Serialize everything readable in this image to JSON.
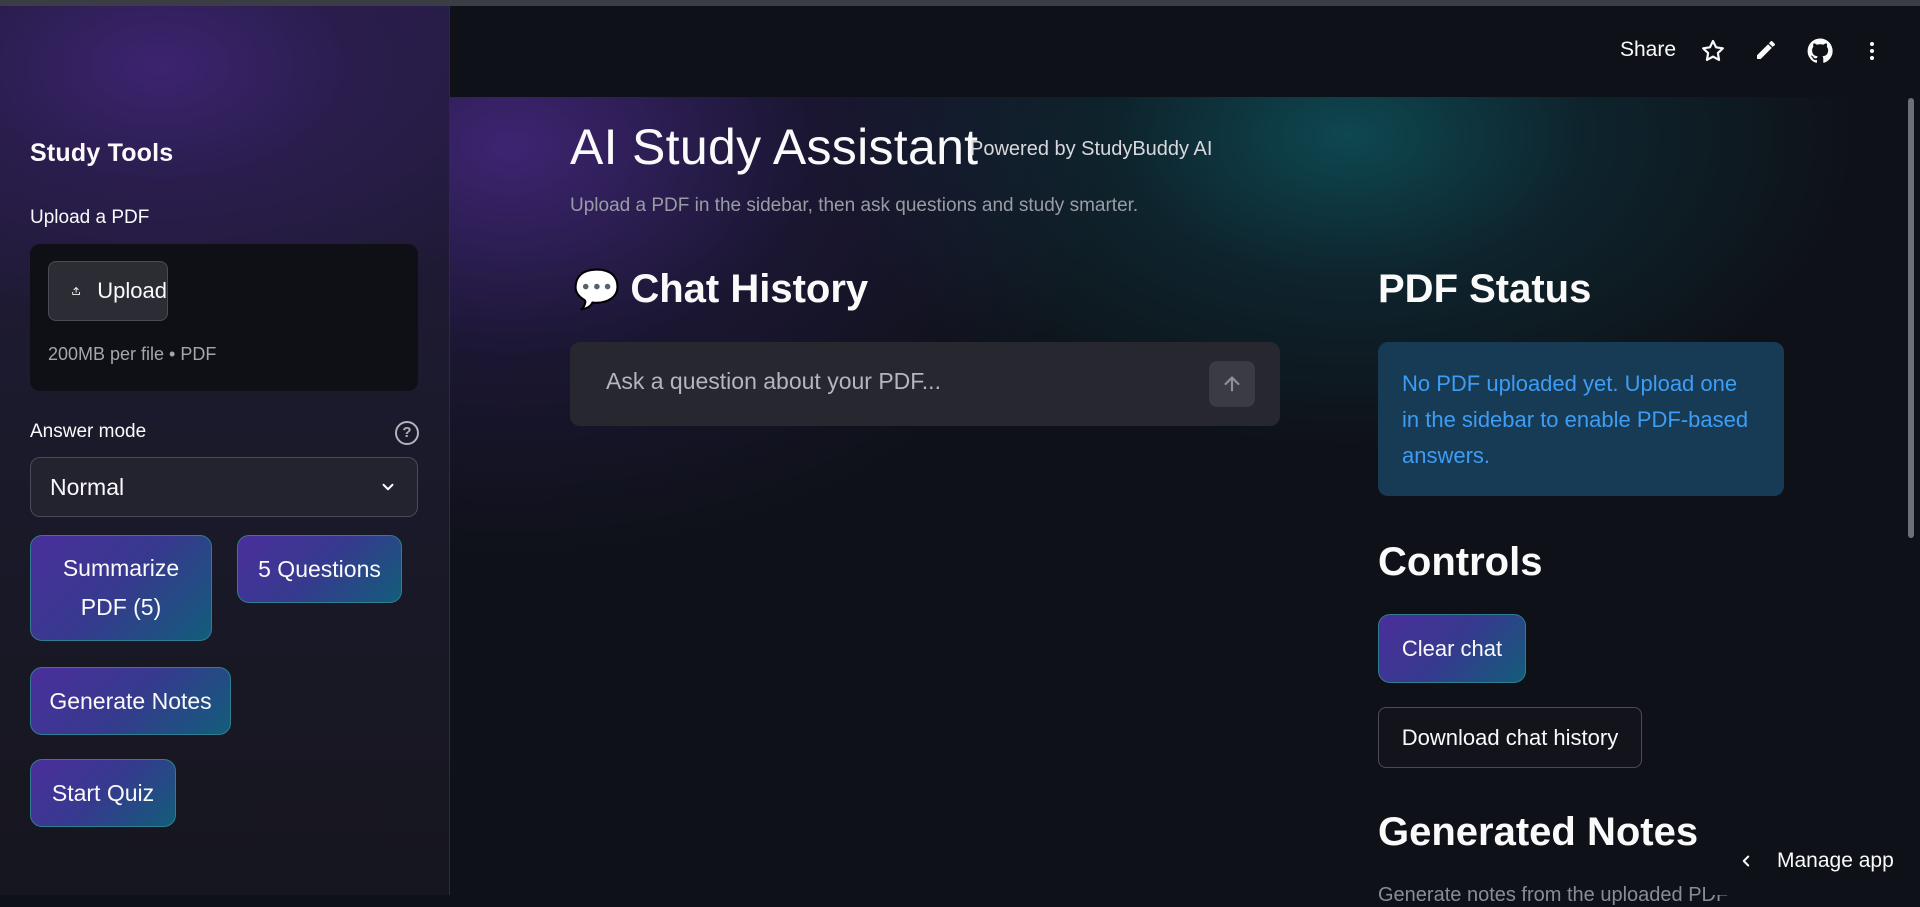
{
  "sidebar": {
    "title": "Study Tools",
    "upload_label": "Upload a PDF",
    "upload_button": "Upload",
    "upload_hint": "200MB per file • PDF",
    "answer_mode_label": "Answer mode",
    "answer_mode_value": "Normal",
    "summarize_button": "Summarize PDF (5)",
    "questions_button": "5 Questions",
    "notes_button": "Generate Notes",
    "quiz_button": "Start Quiz"
  },
  "header": {
    "share": "Share",
    "icons": [
      "star-icon",
      "pencil-icon",
      "github-icon",
      "more-vertical-icon"
    ]
  },
  "main": {
    "title": "AI Study Assistant",
    "subtitle": "Powered by StudyBuddy AI",
    "caption": "Upload a PDF in the sidebar, then ask questions and study smarter.",
    "chat_heading": "Chat History",
    "chat_heading_icon": "💬",
    "chat_placeholder": "Ask a question about your PDF...",
    "pdf_status_heading": "PDF Status",
    "pdf_status_message": "No PDF uploaded yet. Upload one in the sidebar to enable PDF-based answers.",
    "controls_heading": "Controls",
    "clear_chat": "Clear chat",
    "download_chat": "Download chat history",
    "notes_heading": "Generated Notes",
    "notes_caption": "Generate notes from the uploaded PDF"
  },
  "footer": {
    "manage_app": "Manage app"
  },
  "colors": {
    "background": "#0e1117",
    "accent_purple": "#4a2e9c",
    "accent_teal": "#125d7a",
    "info_text": "#3d9df5",
    "info_bg": "#173a55"
  }
}
